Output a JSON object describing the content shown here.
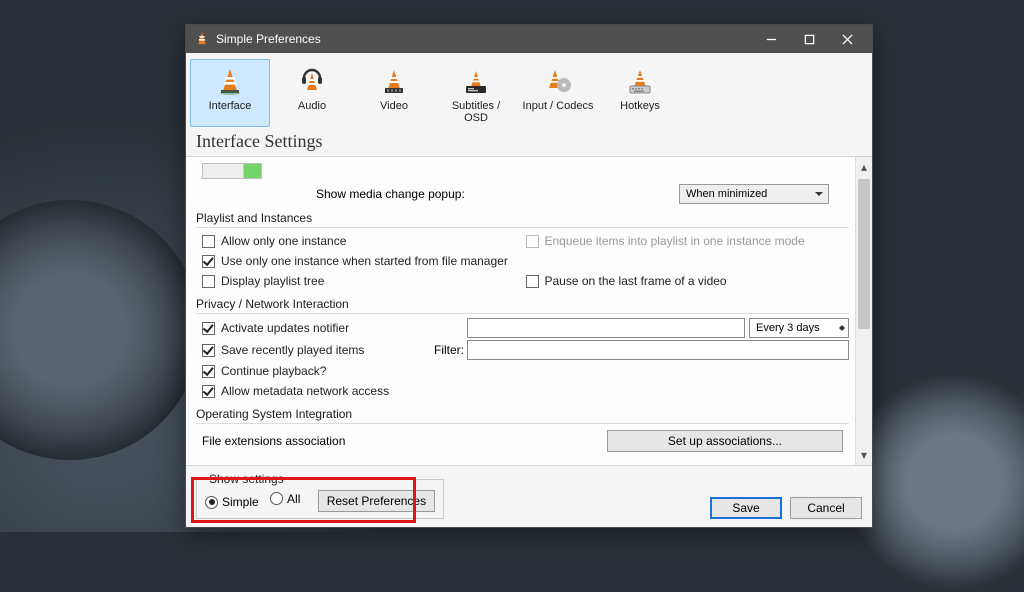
{
  "window": {
    "title": "Simple Preferences"
  },
  "tabs": {
    "interface": "Interface",
    "audio": "Audio",
    "video": "Video",
    "subtitles": "Subtitles / OSD",
    "input": "Input / Codecs",
    "hotkeys": "Hotkeys"
  },
  "heading": "Interface Settings",
  "popupRow": {
    "label": "Show media change popup:",
    "value": "When minimized"
  },
  "groups": {
    "playlist": "Playlist and Instances",
    "privacy": "Privacy / Network Interaction",
    "os": "Operating System Integration"
  },
  "playlist": {
    "allowOne": {
      "label": "Allow only one instance",
      "checked": false
    },
    "enqueue": {
      "label": "Enqueue items into playlist in one instance mode",
      "checked": false
    },
    "oneFromFM": {
      "label": "Use only one instance when started from file manager",
      "checked": true
    },
    "displayTree": {
      "label": "Display playlist tree",
      "checked": false
    },
    "pauseLast": {
      "label": "Pause on the last frame of a video",
      "checked": false
    }
  },
  "privacy": {
    "updates": {
      "label": "Activate updates notifier",
      "checked": true,
      "interval": "Every 3 days"
    },
    "recent": {
      "label": "Save recently played items",
      "checked": true
    },
    "filterLabel": "Filter:",
    "continuePb": {
      "label": "Continue playback?",
      "checked": true
    },
    "metadata": {
      "label": "Allow metadata network access",
      "checked": true
    }
  },
  "os": {
    "assocLabel": "File extensions association",
    "assocButton": "Set up associations..."
  },
  "footer": {
    "legend": "Show settings",
    "simple": "Simple",
    "all": "All",
    "reset": "Reset Preferences",
    "save": "Save",
    "cancel": "Cancel"
  }
}
